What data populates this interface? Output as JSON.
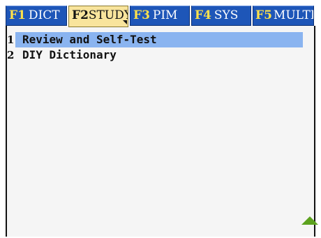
{
  "tabs": [
    {
      "key": "F1",
      "label": "DICT"
    },
    {
      "key": "F2",
      "label": "STUDY"
    },
    {
      "key": "F3",
      "label": "PIM"
    },
    {
      "key": "F4",
      "label": "SYS"
    },
    {
      "key": "F5",
      "label": "MULTI"
    }
  ],
  "active_tab": "F2",
  "menu": {
    "items": [
      {
        "number": "1",
        "label": "Review and Self-Test"
      },
      {
        "number": "2",
        "label": "DIY Dictionary"
      }
    ],
    "selected_index": 0
  },
  "colors": {
    "tab_background": "#1e56b8",
    "tab_key": "#ffe24a",
    "active_tab_background": "#f8e49c",
    "selection_highlight": "#8ab4f0",
    "scroll_arrow": "#5ca21e"
  },
  "icons": {
    "scroll": "scroll-up-arrow-icon",
    "active_tab_marker": "dropdown-corner-icon"
  }
}
